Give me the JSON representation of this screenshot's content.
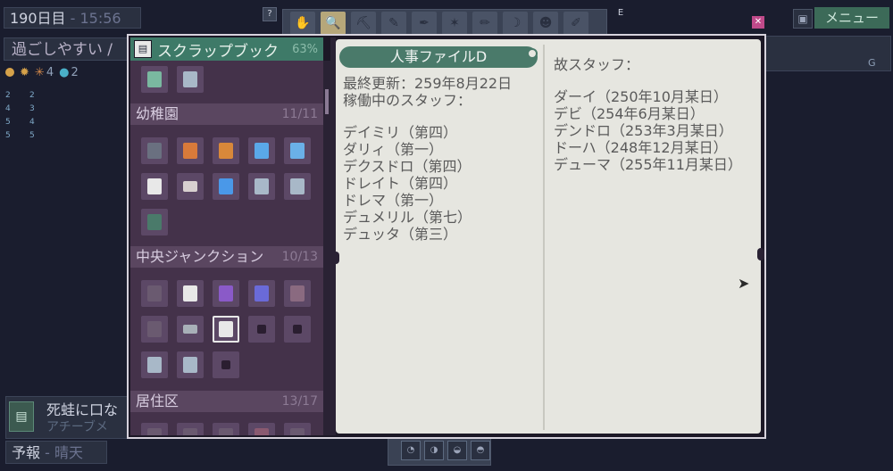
{
  "hud": {
    "day": "190日目",
    "time": "- 15:56",
    "mood": "過ごしやすい /",
    "stats": {
      "sun": "",
      "stat3": "4",
      "stat4": "2"
    },
    "minigrid": [
      "2",
      "2",
      "4",
      "3",
      "5",
      "4",
      "5",
      "5"
    ]
  },
  "toolbar": {
    "help": "?",
    "e_key": "E",
    "tools": [
      "",
      "",
      "",
      "",
      "",
      "",
      "",
      "",
      "",
      "",
      ""
    ]
  },
  "top_right": {
    "close": "✕",
    "menu": "メニュー",
    "bar_letter": "G"
  },
  "notice": {
    "title": "死蛙に口な",
    "subtitle": "アチーブメ"
  },
  "forecast": {
    "label": "予報",
    "value": "- 晴天"
  },
  "scrapbook": {
    "title": "スクラップブック",
    "percent": "63%",
    "sections": [
      {
        "name": "幼稚園",
        "count": "11/11"
      },
      {
        "name": "中央ジャンクション",
        "count": "10/13"
      },
      {
        "name": "居住区",
        "count": "13/17"
      }
    ]
  },
  "notebook": {
    "tab_title": "人事ファイルD",
    "last_updated": "最終更新：259年8月22日",
    "active_heading": "稼働中のスタッフ：",
    "active_staff": [
      "デイミリ（第四）",
      "ダリィ（第一）",
      "デクスドロ（第四）",
      "ドレイト（第四）",
      "ドレマ（第一）",
      "デュメリル（第七）",
      "デュッタ（第三）"
    ],
    "deceased_heading": "故スタッフ：",
    "deceased_staff": [
      "ダーイ（250年10月某日）",
      "デビ（254年6月某日）",
      "デンドロ（253年3月某日）",
      "ドーハ（248年12月某日）",
      "デューマ（255年11月某日）"
    ]
  },
  "colors": {
    "accent_green": "#3e7a68",
    "panel_purple": "#44324a",
    "paper": "#e6e6e0"
  }
}
